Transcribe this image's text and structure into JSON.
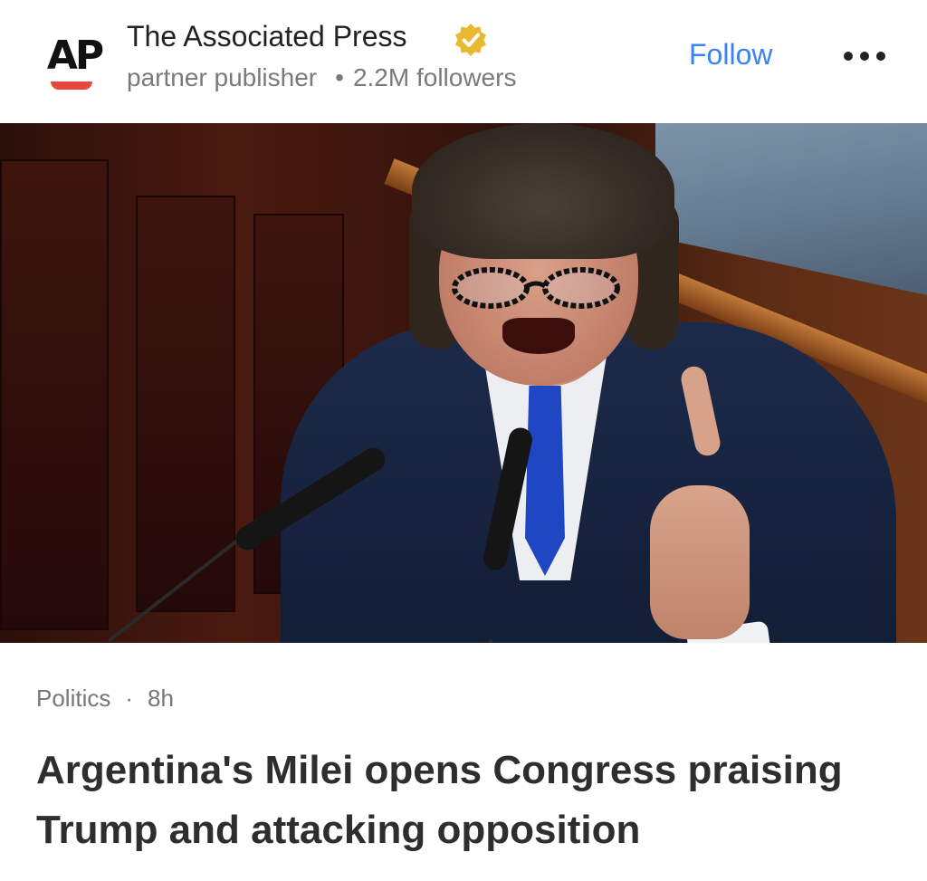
{
  "publisher": {
    "logo_text": "AP",
    "name": "The Associated Press",
    "type": "partner publisher",
    "separator": "•",
    "followers": "2.2M followers",
    "verified_icon": "verified-badge-icon",
    "follow_label": "Follow",
    "more_icon": "more-horizontal-icon"
  },
  "hero_image": {
    "alt": "Man in dark suit and blue tie with round glasses shouting and pointing at a podium microphone"
  },
  "article": {
    "category": "Politics",
    "separator": "·",
    "age": "8h",
    "headline": "Argentina's Milei opens Congress praising Trump and attacking opposition"
  },
  "colors": {
    "accent": "#3b82f6",
    "logo_underline": "#e8473b",
    "verified": "#e8b931",
    "tie": "#1f47c4"
  }
}
